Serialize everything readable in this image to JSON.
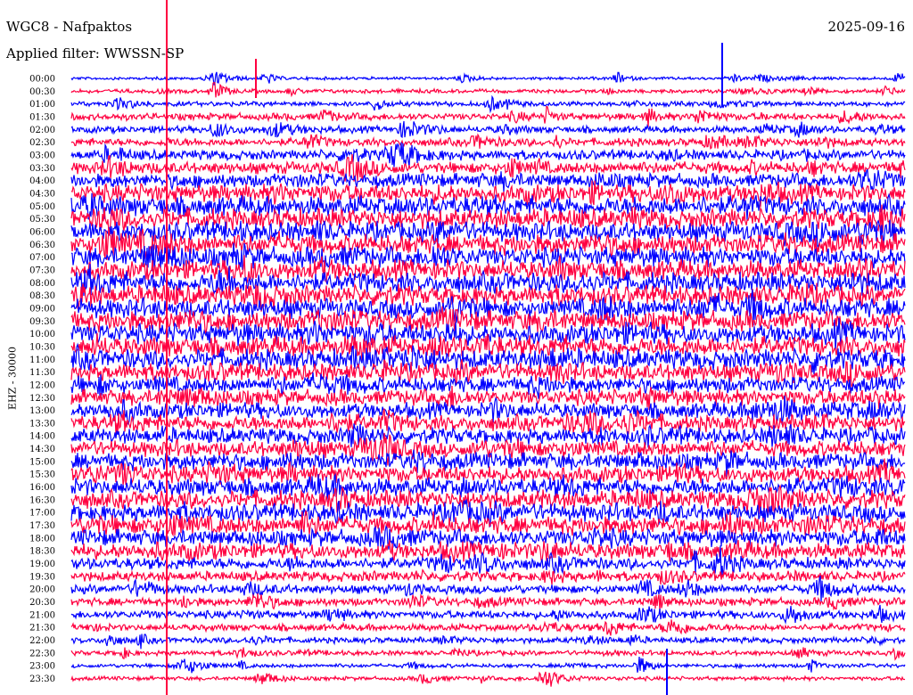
{
  "header": {
    "station": "WGC8 - Nafpaktos",
    "filter": "Applied filter: WWSSN-SP",
    "date": "2025-09-16",
    "channel": "EHZ - 30000"
  },
  "chart_data": {
    "type": "line",
    "title": "WGC8 - Nafpaktos",
    "subtitle": "Applied filter: WWSSN-SP",
    "date": "2025-09-16",
    "ylabel": "EHZ - 30000",
    "row_labels": [
      "00:00",
      "00:30",
      "01:00",
      "01:30",
      "02:00",
      "02:30",
      "03:00",
      "03:30",
      "04:00",
      "04:30",
      "05:00",
      "05:30",
      "06:00",
      "06:30",
      "07:00",
      "07:30",
      "08:00",
      "08:30",
      "09:00",
      "09:30",
      "10:00",
      "10:30",
      "11:00",
      "11:30",
      "12:00",
      "12:30",
      "13:00",
      "13:30",
      "14:00",
      "14:30",
      "15:00",
      "15:30",
      "16:00",
      "16:30",
      "17:00",
      "17:30",
      "18:00",
      "18:30",
      "19:00",
      "19:30",
      "20:00",
      "20:30",
      "21:00",
      "21:30",
      "22:00",
      "22:30",
      "23:00",
      "23:30"
    ],
    "series_colors": [
      "#0000ff",
      "#ff0040"
    ],
    "relative_amplitude": [
      0.15,
      0.2,
      0.25,
      0.35,
      0.35,
      0.4,
      0.5,
      0.6,
      0.7,
      0.9,
      1,
      1,
      1,
      1,
      1,
      1,
      1,
      1,
      1,
      1,
      1,
      1,
      1,
      0.9,
      0.8,
      0.8,
      0.8,
      0.8,
      0.8,
      0.8,
      0.85,
      0.85,
      0.9,
      0.9,
      0.9,
      0.9,
      0.85,
      0.8,
      0.6,
      0.5,
      0.45,
      0.4,
      0.4,
      0.35,
      0.3,
      0.25,
      0.2,
      0.2
    ],
    "grid": false
  }
}
